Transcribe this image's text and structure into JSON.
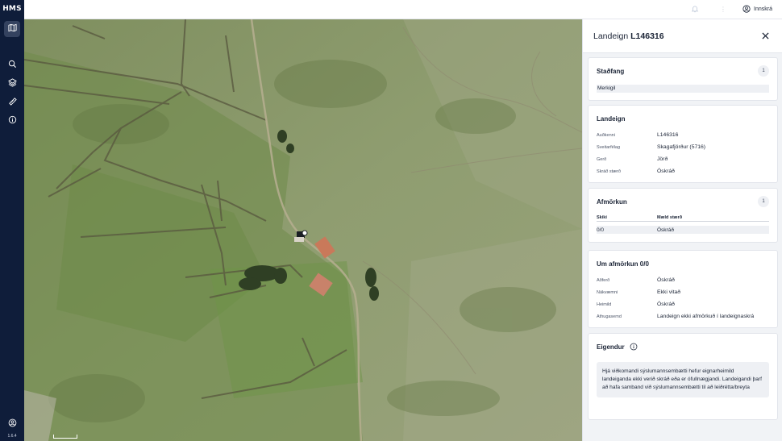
{
  "app": {
    "logo": "HMS",
    "version": "1.6.4"
  },
  "rail": {
    "items": [
      {
        "name": "map-icon"
      },
      {
        "name": "search-icon"
      },
      {
        "name": "layers-icon"
      },
      {
        "name": "ruler-icon"
      },
      {
        "name": "info-icon"
      }
    ],
    "account_icon": "user-circle-icon"
  },
  "topbar": {
    "login_label": "Innskrá"
  },
  "panel": {
    "title_prefix": "Landeign",
    "title_id": "L146316",
    "stadfang": {
      "title": "Staðfang",
      "count": "1",
      "address": "Merkigil"
    },
    "landeign": {
      "title": "Landeign",
      "rows": [
        {
          "k": "Auðkenni",
          "v": "L146316"
        },
        {
          "k": "Sveitarfélag",
          "v": "Skagafjörður (5716)"
        },
        {
          "k": "Gerð",
          "v": "Jörð"
        },
        {
          "k": "Skráð stærð",
          "v": "Óskráð"
        }
      ]
    },
    "afmorkun": {
      "title": "Afmörkun",
      "count": "1",
      "col1": "Skiki",
      "col2": "Mæld stærð",
      "row_skiki": "0/0",
      "row_size": "Óskráð"
    },
    "um_afmorkun": {
      "title": "Um afmörkun 0/0",
      "rows": [
        {
          "k": "Aðferð",
          "v": "Óskráð"
        },
        {
          "k": "Nákvæmni",
          "v": "Ekki vitað"
        },
        {
          "k": "Heimild",
          "v": "Óskráð"
        },
        {
          "k": "Athugasemd",
          "v": "Landeign ekki afmörkuð í landeignaskrá"
        }
      ]
    },
    "eigendur": {
      "title": "Eigendur",
      "note": "Hjá viðkomandi sýslumannsembætti hefur eignarheimild landeiganda ekki verið skráð eða er ófullnægjandi. Landeigandi þarf að hafa samband við sýslumannsembætti til að leiðrétta/breyta"
    }
  },
  "colors": {
    "rail_bg": "#0f1d3a",
    "panel_bg": "#f1f3f6",
    "map_green": "#8a9a6a"
  }
}
